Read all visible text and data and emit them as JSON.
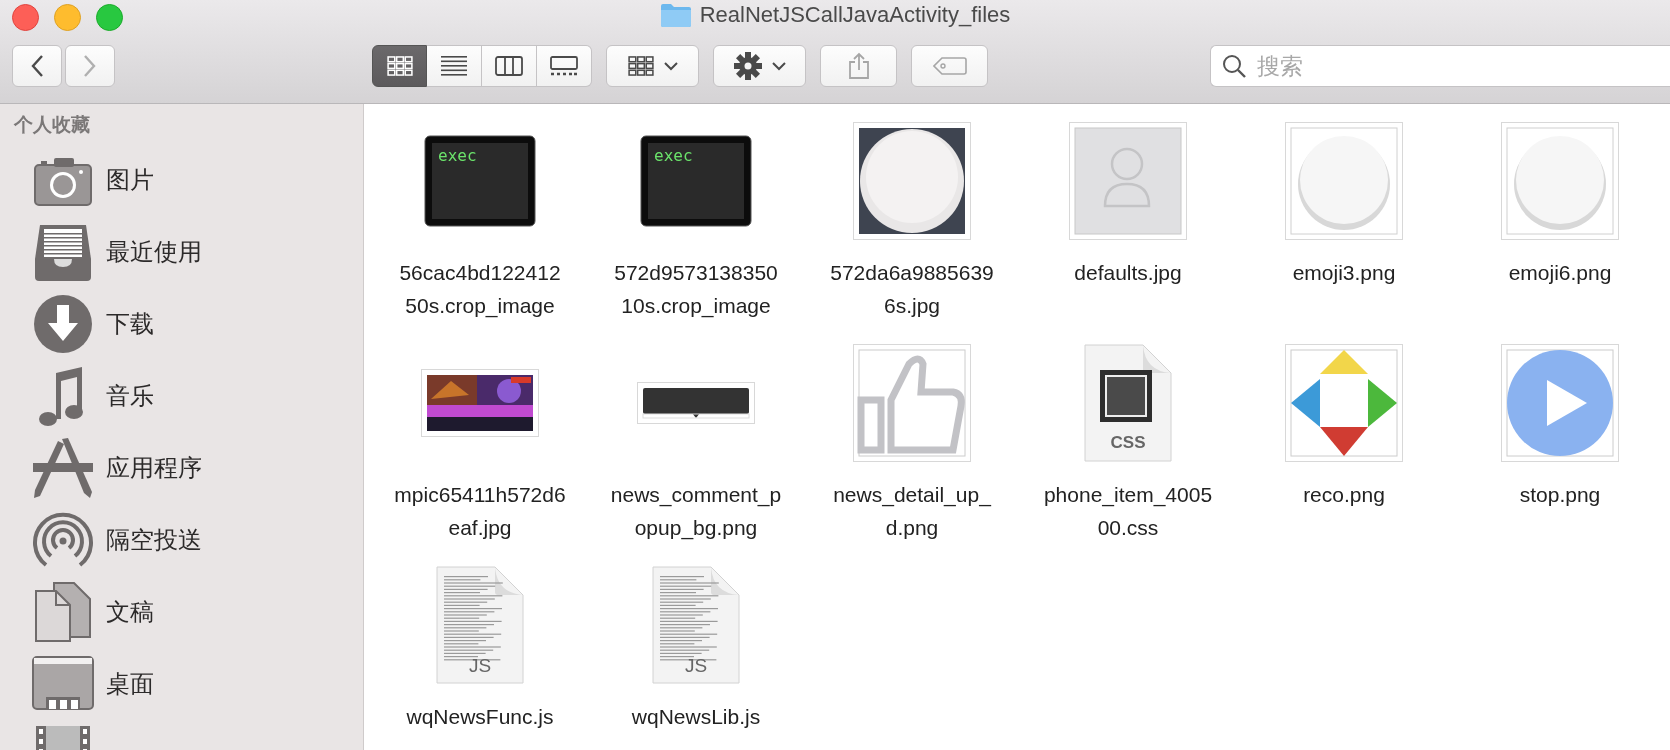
{
  "window": {
    "title": "RealNetJSCallJavaActivity_files"
  },
  "toolbar": {
    "view_modes": [
      {
        "selected": true
      },
      {
        "selected": false
      },
      {
        "selected": false
      },
      {
        "selected": false
      }
    ],
    "search": {
      "placeholder": "搜索"
    }
  },
  "sidebar": {
    "section": "个人收藏",
    "items": [
      {
        "label": "图片"
      },
      {
        "label": "最近使用"
      },
      {
        "label": "下载"
      },
      {
        "label": "音乐"
      },
      {
        "label": "应用程序"
      },
      {
        "label": "隔空投送"
      },
      {
        "label": "文稿"
      },
      {
        "label": "桌面"
      },
      {
        "kind": "partial"
      }
    ]
  },
  "files": [
    {
      "name": "56cac4bd12241250s.crop_image",
      "kind": "terminal",
      "icon_text": "exec"
    },
    {
      "name": "572d957313835010s.crop_image",
      "kind": "terminal",
      "icon_text": "exec"
    },
    {
      "name": "572da6a98856396s.jpg",
      "kind": "thumbnail"
    },
    {
      "name": "defaults.jpg",
      "kind": "thumbnail"
    },
    {
      "name": "emoji3.png",
      "kind": "thumbnail"
    },
    {
      "name": "emoji6.png",
      "kind": "thumbnail"
    },
    {
      "name": "mpic65411h572d6eaf.jpg",
      "kind": "thumbnail"
    },
    {
      "name": "news_comment_popup_bg.png",
      "kind": "thumbnail"
    },
    {
      "name": "news_detail_up_d.png",
      "kind": "thumbnail"
    },
    {
      "name": "phone_item_400500.css",
      "kind": "document",
      "badge": "CSS"
    },
    {
      "name": "reco.png",
      "kind": "thumbnail"
    },
    {
      "name": "stop.png",
      "kind": "thumbnail"
    },
    {
      "name": "wqNewsFunc.js",
      "kind": "document",
      "badge": "JS"
    },
    {
      "name": "wqNewsLib.js",
      "kind": "document",
      "badge": "JS"
    }
  ]
}
